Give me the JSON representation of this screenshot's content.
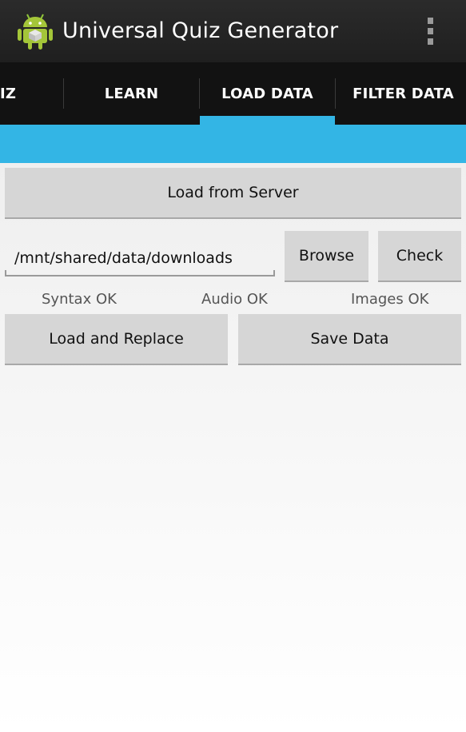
{
  "app": {
    "title": "Universal Quiz Generator",
    "icon": "android-robot-icon",
    "overflow_icon": "overflow-menu-icon"
  },
  "tabs": [
    {
      "label": "IZ"
    },
    {
      "label": "LEARN"
    },
    {
      "label": "LOAD DATA",
      "selected": true
    },
    {
      "label": "FILTER DATA"
    }
  ],
  "colors": {
    "accent": "#33b5e5",
    "actionbar": "#222222",
    "tabbar": "#121212",
    "button": "#d6d6d6"
  },
  "load": {
    "server_button": "Load from Server",
    "path_value": "/mnt/shared/data/downloads",
    "browse_button": "Browse",
    "check_button": "Check",
    "status": {
      "syntax": "Syntax OK",
      "audio": "Audio OK",
      "images": "Images OK"
    },
    "replace_button": "Load and Replace",
    "save_button": "Save Data"
  }
}
